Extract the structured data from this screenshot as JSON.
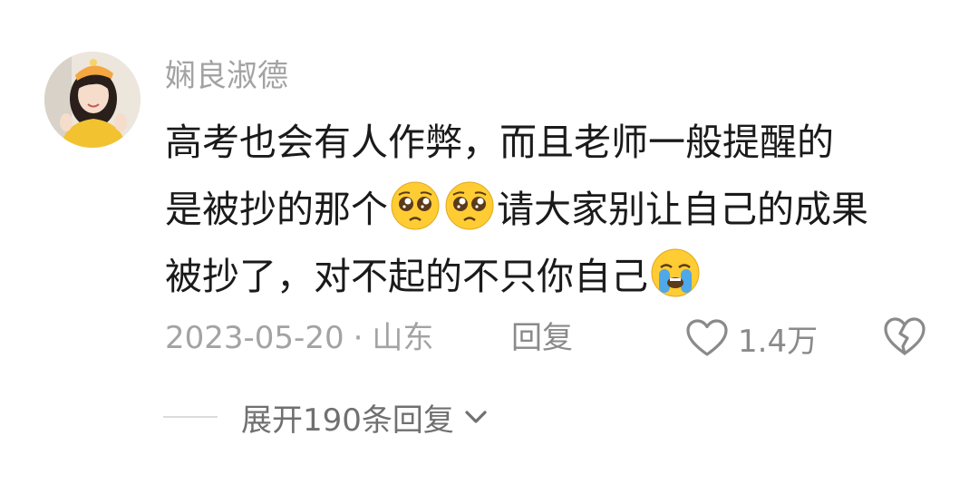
{
  "comment": {
    "username": "娴良淑德",
    "content_lines": [
      {
        "before": "高考也会有人作弊，而且老师一般提醒的",
        "emojis": [],
        "after": ""
      },
      {
        "before": "是被抄的那个",
        "emojis": [
          "pleading-face-emoji",
          "pleading-face-emoji"
        ],
        "after": "请大家别让自己的成果"
      },
      {
        "before": "被抄了，对不起的不只你自己",
        "emojis": [
          "loudly-crying-face-emoji"
        ],
        "after": ""
      }
    ],
    "date": "2023-05-20",
    "separator": "·",
    "location": "山东",
    "reply_label": "回复",
    "like_count": "1.4万",
    "expand_label": "展开190条回复"
  },
  "icons": {
    "like": "heart-outline-icon",
    "dislike": "broken-heart-icon",
    "expand": "chevron-down-icon"
  },
  "colors": {
    "background": "#ffffff",
    "username": "#a3a3a3",
    "content_text": "#1a1a1a",
    "meta_text": "#a3a3a3",
    "action_text": "#8a8a8a",
    "emoji_yellow": "#ffcc33"
  }
}
